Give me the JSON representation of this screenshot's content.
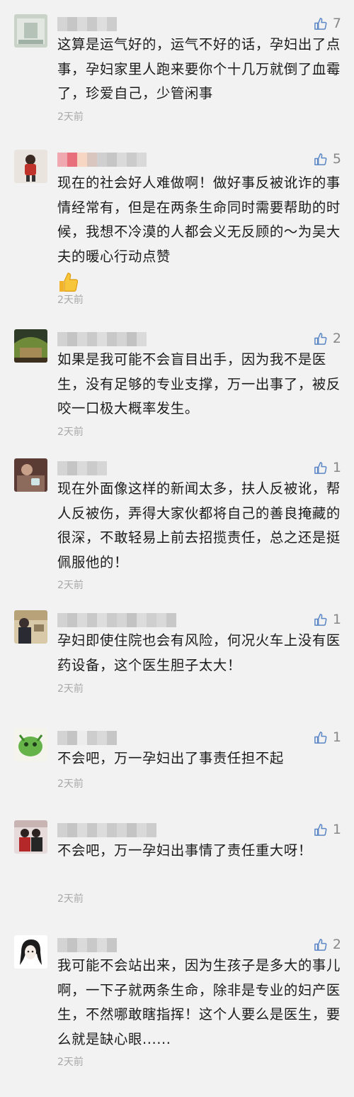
{
  "comments": [
    {
      "likes": "7",
      "text": "这算是运气好的，运气不好的话，孕妇出了点事，孕妇家里人跑来要你个十几万就倒了血霉了，珍爱自己，少管闲事",
      "time": "2天前"
    },
    {
      "likes": "5",
      "text": "现在的社会好人难做啊！做好事反被讹诈的事情经常有，但是在两条生命同时需要帮助的时候，我想不冷漠的人都会义无反顾的～为吴大夫的暖心行动点赞",
      "time": "2天前"
    },
    {
      "likes": "2",
      "text": "如果是我可能不会盲目出手，因为我不是医生，没有足够的专业支撑，万一出事了，被反咬一口极大概率发生。",
      "time": "2天前"
    },
    {
      "likes": "1",
      "text": "现在外面像这样的新闻太多，扶人反被讹，帮人反被伤，弄得大家伙都将自己的善良掩藏的很深，不敢轻易上前去招揽责任，总之还是挺佩服他的！",
      "time": "2天前"
    },
    {
      "likes": "1",
      "text": "孕妇即使住院也会有风险，何况火车上没有医药设备，这个医生胆子太大！",
      "time": "2天前"
    },
    {
      "likes": "1",
      "text": "不会吧，万一孕妇出了事责任担不起",
      "time": "2天前"
    },
    {
      "likes": "1",
      "text": "不会吧，万一孕妇出事情了责任重大呀！",
      "time": "2天前"
    },
    {
      "likes": "2",
      "text": "我可能不会站出来，因为生孩子是多大的事儿啊，一下子就两条生命，除非是专业的妇产医生，不然哪敢瞎指挥！这个人要么是医生，要么就是缺心眼......",
      "time": "2天前"
    }
  ]
}
